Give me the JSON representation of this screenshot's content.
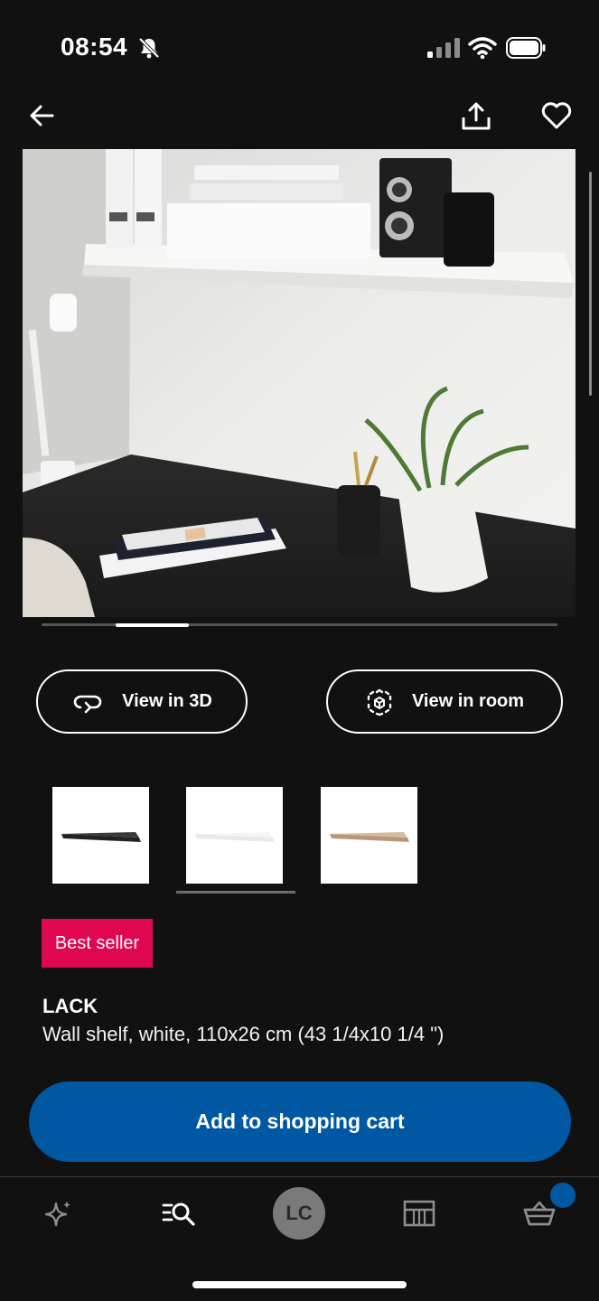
{
  "status_bar": {
    "time": "08:54"
  },
  "product": {
    "badge": "Best seller",
    "name": "LACK",
    "description": "Wall shelf, white, 110x26 cm (43 1/4x10 1/4 \")"
  },
  "actions": {
    "view_3d": "View in 3D",
    "view_room": "View in room",
    "add_to_cart": "Add to shopping cart"
  },
  "color_options": [
    {
      "name": "black-brown",
      "color": "#2b2b2b"
    },
    {
      "name": "white",
      "color": "#f4f4f4",
      "selected": true
    },
    {
      "name": "oak effect",
      "color": "#c9a88a"
    }
  ],
  "carousel": {
    "active_index": 1
  },
  "tab_bar": {
    "account_initials": "LC",
    "items": [
      "inspire-icon",
      "search-icon",
      "account",
      "store-icon",
      "cart-icon"
    ]
  },
  "colors": {
    "brand_blue": "#0058a3",
    "badge_red": "#e00751",
    "background": "#111111"
  }
}
